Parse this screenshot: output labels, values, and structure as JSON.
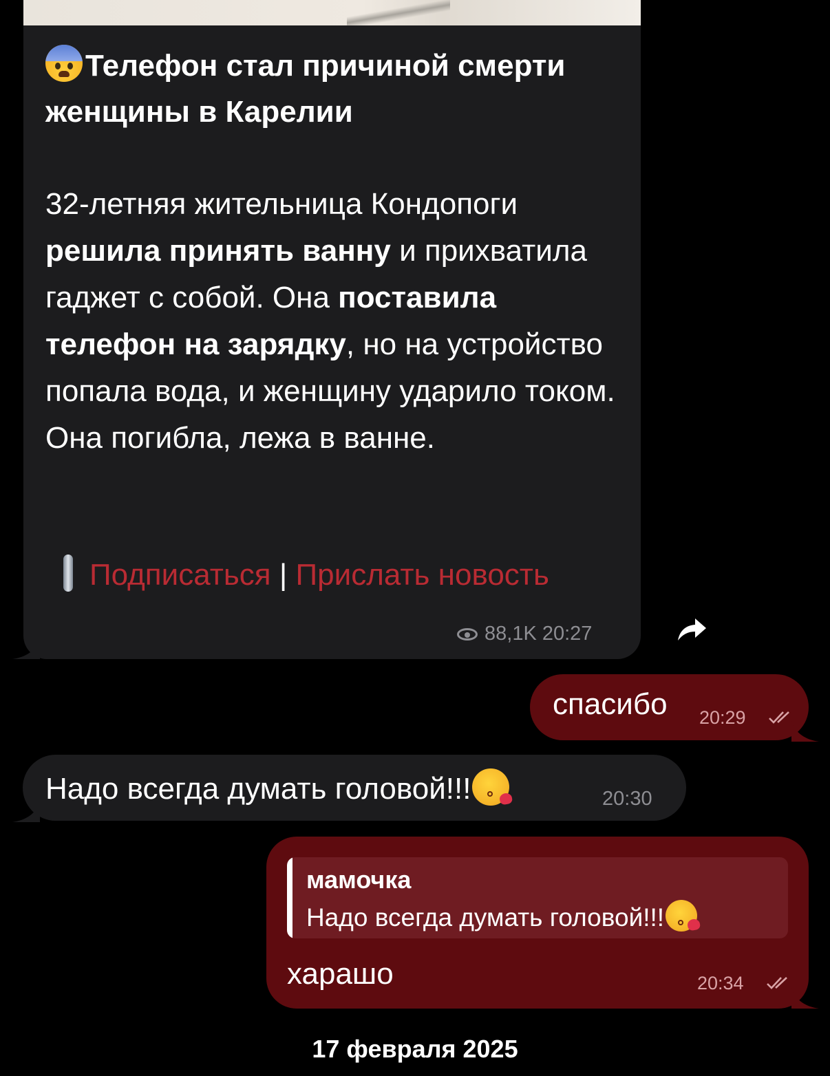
{
  "post": {
    "title": "Телефон стал причиной смерти женщины в Карелии",
    "body_1": "32-летняя жительница Кондопоги ",
    "body_bold_1": "решила принять ванну",
    "body_2": " и прихватила гаджет с собой. Она ",
    "body_bold_2": "поставила телефон на зарядку",
    "body_3": ", но на устройство попала вода, и женщину ударило током. Она погибла, лежа в ванне.",
    "subscribe_link": "Подписаться",
    "separator": "|",
    "send_news_link": "Прислать новость",
    "views": "88,1K",
    "time": "20:27",
    "title_emoji": "fearful-face-emoji",
    "footer_icon": "pin-icon"
  },
  "messages": [
    {
      "direction": "out",
      "text": "спасибо",
      "time": "20:29",
      "status": "read"
    },
    {
      "direction": "in",
      "text": "Надо всегда думать головой!!!",
      "time": "20:30",
      "emoji": "face-blowing-kiss-emoji"
    },
    {
      "direction": "out",
      "reply_author": "мамочка",
      "reply_text": "Надо всегда думать головой!!!",
      "text": "харашо",
      "time": "20:34",
      "status": "read"
    }
  ],
  "date_separator": "17 февраля 2025",
  "colors": {
    "background": "#000000",
    "incoming_bubble": "#1c1c1e",
    "outgoing_bubble": "#5e0b0f",
    "link": "#b92b33",
    "meta_gray": "#8e8e93"
  }
}
